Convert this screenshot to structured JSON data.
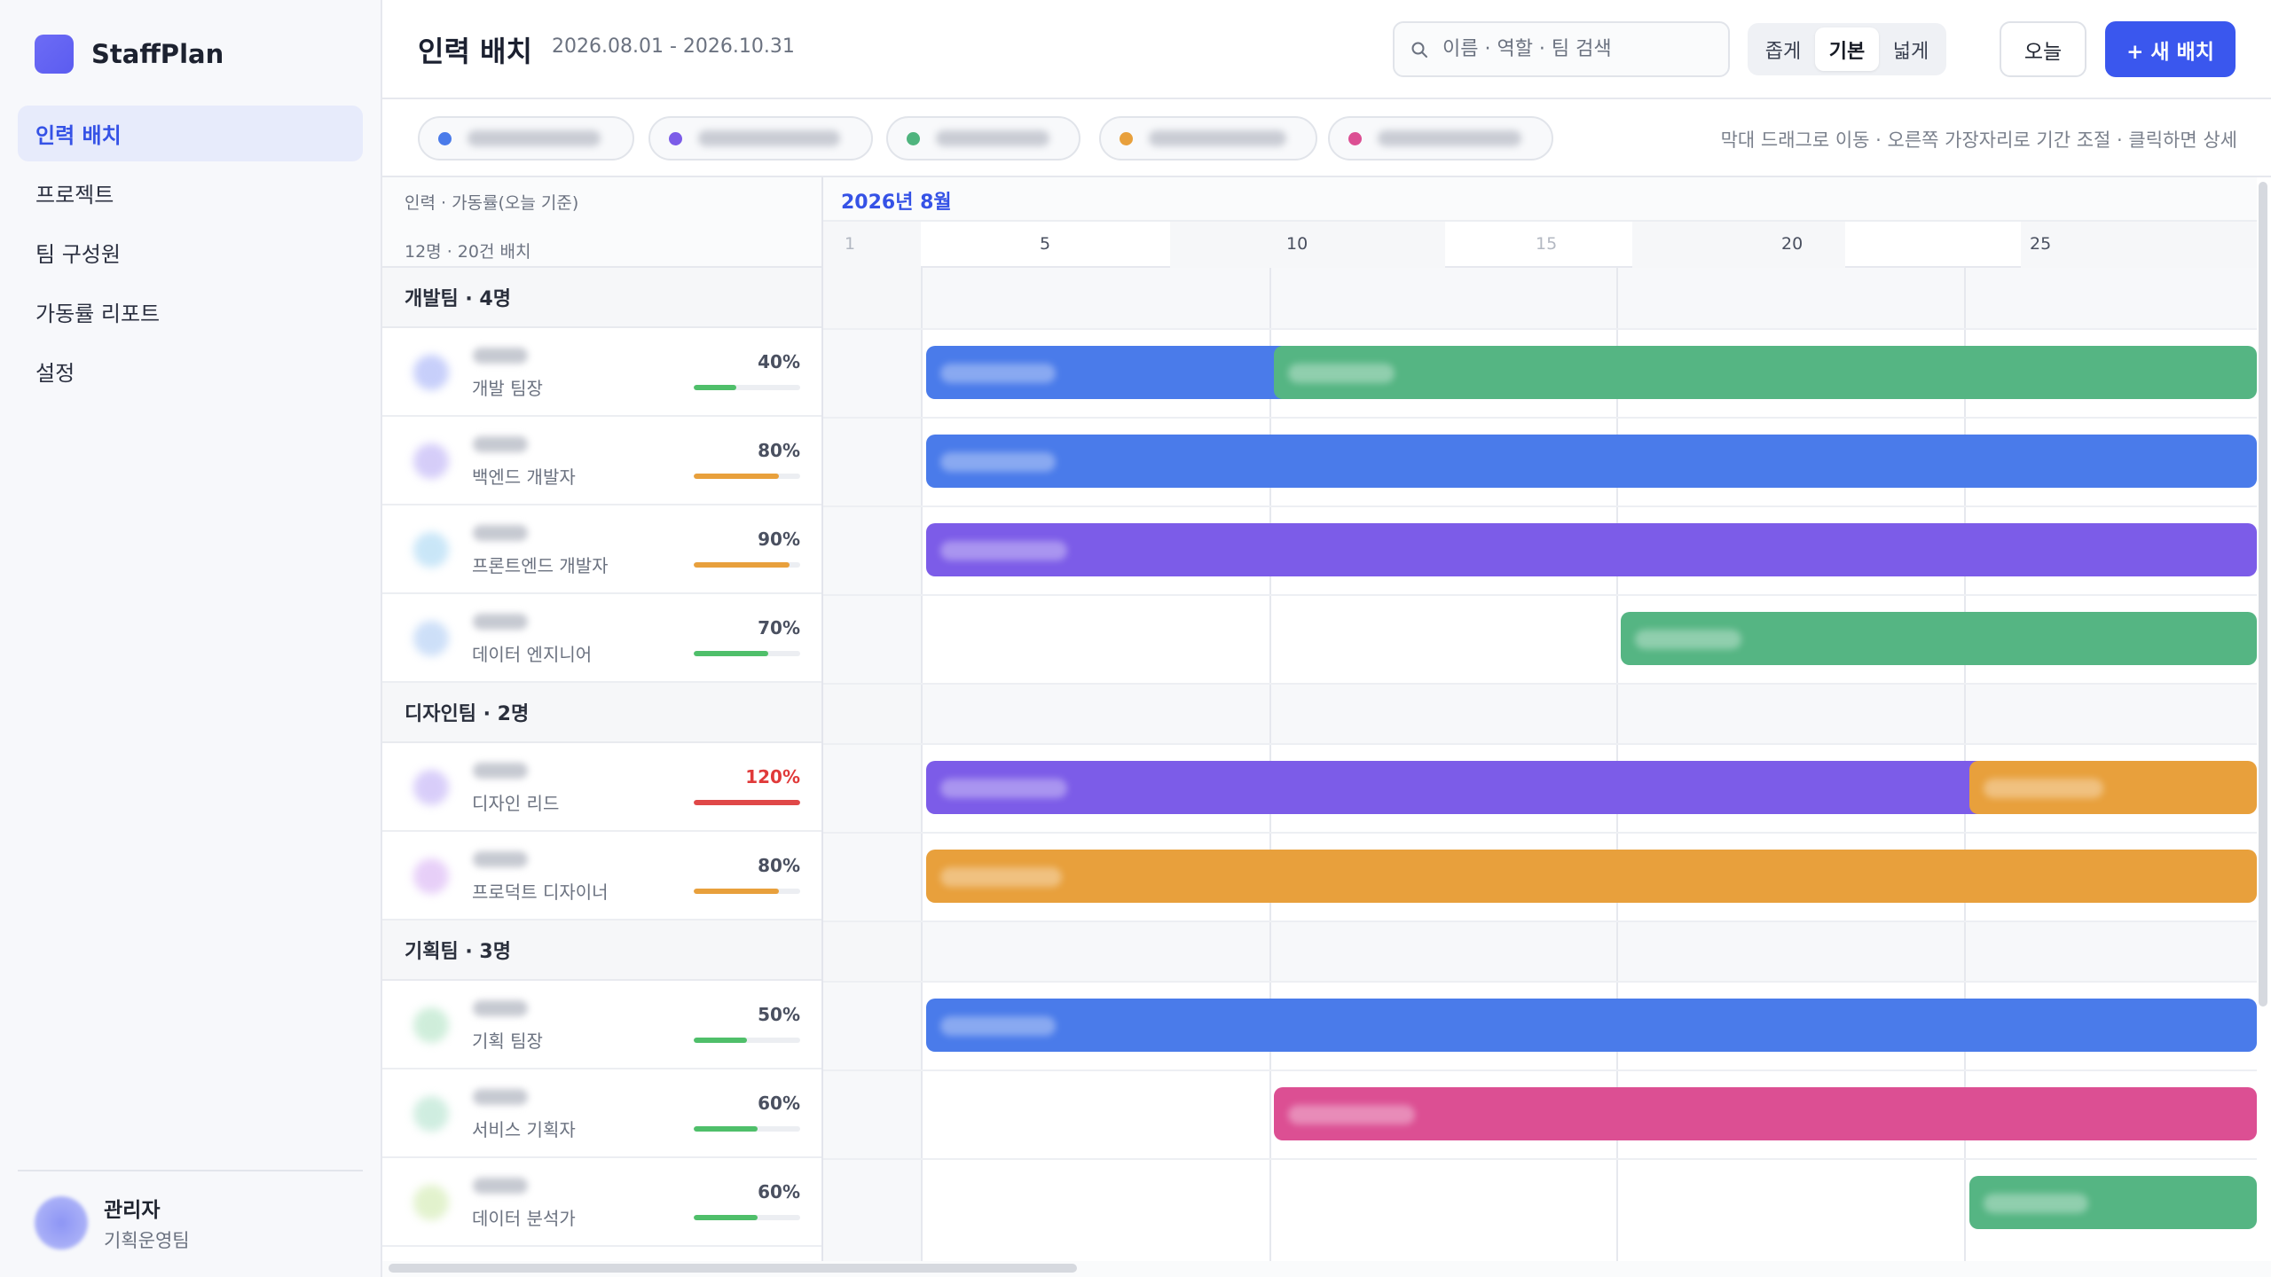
{
  "app": {
    "name": "StaffPlan"
  },
  "sidebar": {
    "items": [
      {
        "label": "인력 배치",
        "active": true
      },
      {
        "label": "프로젝트",
        "active": false
      },
      {
        "label": "팀 구성원",
        "active": false
      },
      {
        "label": "가동률 리포트",
        "active": false
      },
      {
        "label": "설정",
        "active": false
      }
    ],
    "user": {
      "name": "관리자",
      "team": "기획운영팀"
    }
  },
  "header": {
    "title": "인력 배치",
    "date_range": "2026.08.01 - 2026.10.31",
    "search_placeholder": "이름 · 역할 · 팀 검색",
    "zoom": [
      "좁게",
      "기본",
      "넓게"
    ],
    "zoom_active": "기본",
    "today": "오늘",
    "new_button": "+ 새 배치"
  },
  "filters": {
    "chips": [
      {
        "color": "#4a7bea"
      },
      {
        "color": "#7c5ce8"
      },
      {
        "color": "#4fb47e"
      },
      {
        "color": "#e8a03c"
      },
      {
        "color": "#dc4f93"
      }
    ],
    "hint": "막대 드래그로 이동 · 오른쪽 가장자리로 기간 조절 · 클릭하면 상세"
  },
  "list": {
    "head_title": "인력 · 가동률(오늘 기준)",
    "head_count": "12명 · 20건 배치",
    "groups": [
      {
        "title": "개발팀 · 4명",
        "people": [
          {
            "role": "개발 팀장",
            "pct": "40%",
            "util": 40,
            "avatar": "#9aa8f7"
          },
          {
            "role": "백엔드 개발자",
            "pct": "80%",
            "util": 80,
            "avatar": "#b3a5f4"
          },
          {
            "role": "프론트엔드 개발자",
            "pct": "90%",
            "util": 90,
            "avatar": "#9ed2f2"
          },
          {
            "role": "데이터 엔지니어",
            "pct": "70%",
            "util": 70,
            "avatar": "#a5c6f3"
          }
        ]
      },
      {
        "title": "디자인팀 · 2명",
        "people": [
          {
            "role": "디자인 리드",
            "pct": "120%",
            "util": 120,
            "avatar": "#b9a6f5"
          },
          {
            "role": "프로덕트 디자이너",
            "pct": "80%",
            "util": 80,
            "avatar": "#d4a9f3"
          }
        ]
      },
      {
        "title": "기획팀 · 3명",
        "people": [
          {
            "role": "기획 팀장",
            "pct": "50%",
            "util": 50,
            "avatar": "#a8e0bd"
          },
          {
            "role": "서비스 기획자",
            "pct": "60%",
            "util": 60,
            "avatar": "#a9dfc7"
          },
          {
            "role": "데이터 분석가",
            "pct": "60%",
            "util": 60,
            "avatar": "#cbe8a5"
          }
        ]
      }
    ]
  },
  "timeline": {
    "month": "2026년 8월",
    "day_labels": [
      "1",
      "5",
      "10",
      "15",
      "20",
      "25"
    ],
    "colors": {
      "blue": "#4a7bea",
      "purple": "#7c5ce8",
      "green": "#4fb47e",
      "orange": "#e8a03c",
      "pink": "#dc4f93"
    }
  }
}
